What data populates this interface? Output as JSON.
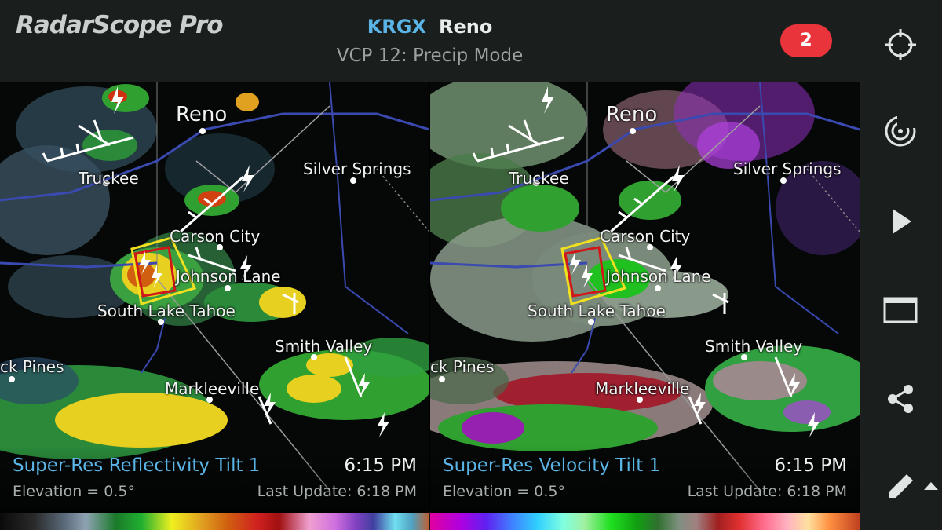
{
  "header": {
    "app_name": "RadarScope Pro",
    "site_code": "KRGX",
    "site_name": "Reno",
    "vcp_text": "VCP 12: Precip Mode",
    "alert_count": "2"
  },
  "sidebar": {
    "buttons": [
      {
        "name": "locate",
        "icon": "crosshair-icon"
      },
      {
        "name": "radar-products",
        "icon": "radar-icon"
      },
      {
        "name": "play-loop",
        "icon": "play-icon"
      },
      {
        "name": "layout",
        "icon": "window-icon"
      },
      {
        "name": "share",
        "icon": "share-icon"
      },
      {
        "name": "draw",
        "icon": "pencil-icon"
      }
    ]
  },
  "panels": [
    {
      "product": "Super-Res Reflectivity Tilt 1",
      "time": "6:15 PM",
      "elevation": "Elevation = 0.5°",
      "last_update": "Last Update: 6:18 PM"
    },
    {
      "product": "Super-Res Velocity Tilt 1",
      "time": "6:15 PM",
      "elevation": "Elevation = 0.5°",
      "last_update": "Last Update: 6:18 PM"
    }
  ],
  "map_labels": {
    "reno": "Reno",
    "truckee": "Truckee",
    "silver_springs": "Silver Springs",
    "carson_city": "Carson City",
    "johnson_lane": "Johnson Lane",
    "south_lake_tahoe": "South Lake Tahoe",
    "smith_valley": "Smith Valley",
    "pines": "ck Pines",
    "markleeville": "Markleeville"
  },
  "colors": {
    "accent_blue": "#5ab4e6",
    "alert_red": "#e8343a",
    "warning_yellow": "#f0e020",
    "warning_red": "#d01818"
  }
}
